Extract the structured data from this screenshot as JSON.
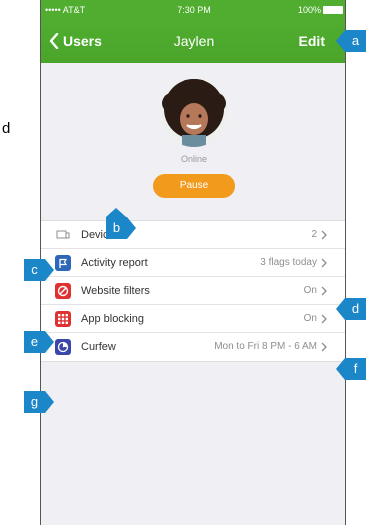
{
  "page_margin_text": "d",
  "status_bar": {
    "carrier": "••••• AT&T",
    "time": "7:30 PM",
    "battery": "100%"
  },
  "nav": {
    "back_label": "Users",
    "title": "Jaylen",
    "edit_label": "Edit"
  },
  "profile": {
    "status": "Online",
    "pause_label": "Pause"
  },
  "rows": [
    {
      "icon": "devices-icon",
      "label": "Devices",
      "value": "2",
      "icon_color": "#e5e5ea"
    },
    {
      "icon": "flag-icon",
      "label": "Activity report",
      "value": "3 flags today",
      "icon_color": "#2f67b8"
    },
    {
      "icon": "block-icon",
      "label": "Website filters",
      "value": "On",
      "icon_color": "#e03131"
    },
    {
      "icon": "grid-icon",
      "label": "App blocking",
      "value": "On",
      "icon_color": "#e03131"
    },
    {
      "icon": "clock-icon",
      "label": "Curfew",
      "value": "Mon to Fri 8 PM - 6 AM",
      "icon_color": "#3b47a8"
    }
  ],
  "callouts": {
    "a": "a",
    "b": "b",
    "c": "c",
    "d": "d",
    "e": "e",
    "f": "f",
    "g": "g"
  },
  "colors": {
    "nav_green": "#50ad2f",
    "pause_orange": "#f19a1c",
    "callout_blue": "#1b86c8"
  }
}
